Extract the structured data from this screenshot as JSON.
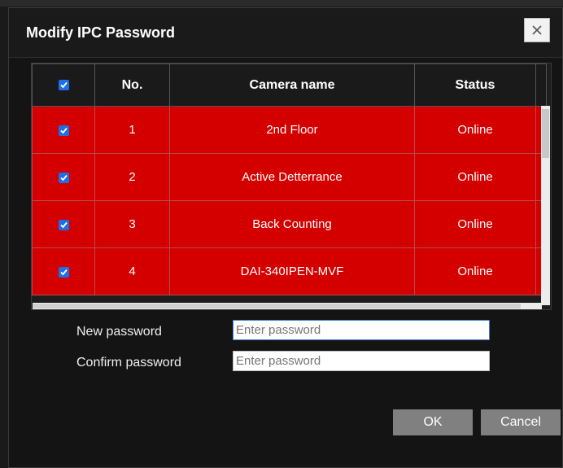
{
  "dialog": {
    "title": "Modify IPC Password",
    "close_icon": "close-icon"
  },
  "table": {
    "headers": {
      "select_all": true,
      "no": "No.",
      "camera_name": "Camera name",
      "status": "Status"
    },
    "rows": [
      {
        "checked": true,
        "no": "1",
        "name": "2nd Floor",
        "status": "Online"
      },
      {
        "checked": true,
        "no": "2",
        "name": "Active Detterrance",
        "status": "Online"
      },
      {
        "checked": true,
        "no": "3",
        "name": "Back Counting",
        "status": "Online"
      },
      {
        "checked": true,
        "no": "4",
        "name": "DAI-340IPEN-MVF",
        "status": "Online"
      }
    ],
    "row_color": "#d40000"
  },
  "form": {
    "new_password_label": "New password",
    "new_password_placeholder": "Enter password",
    "confirm_password_label": "Confirm password",
    "confirm_password_placeholder": "Enter password"
  },
  "buttons": {
    "ok": "OK",
    "cancel": "Cancel"
  },
  "colors": {
    "accent": "#1e6ee8",
    "row_selected": "#d40000",
    "button": "#808080"
  }
}
